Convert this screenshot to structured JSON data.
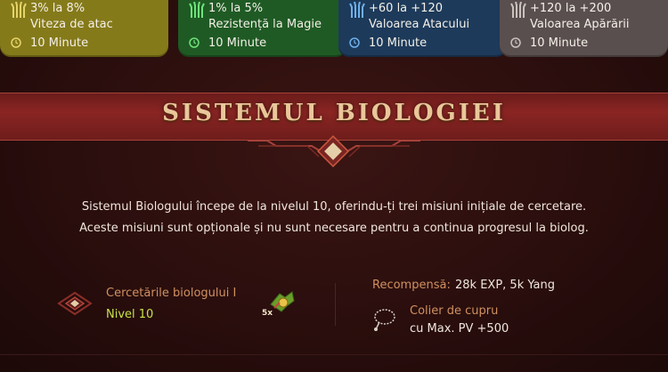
{
  "buffs": [
    {
      "icon": "claw-icon",
      "color": "#857a1a",
      "line1": "3% la 8%",
      "line2": "Viteza de atac",
      "duration": "10 Minute"
    },
    {
      "icon": "claw-icon",
      "color": "#1f5a24",
      "line1": "1% la 5%",
      "line2": "Rezistență la Magie",
      "duration": "10 Minute"
    },
    {
      "icon": "claw-icon",
      "color": "#1d3a5a",
      "line1": "+60 la +120",
      "line2": "Valoarea Atacului",
      "duration": "10 Minute"
    },
    {
      "icon": "claw-icon",
      "color": "#5a4f4f",
      "line1": "+120 la +200",
      "line2": "Valoarea Apărării",
      "duration": "10 Minute"
    }
  ],
  "section": {
    "title": "SISTEMUL BIOLOGIEI",
    "description_line1": "Sistemul Biologului începe de la nivelul 10, oferindu-ți trei misiuni inițiale de cercetare.",
    "description_line2": "Aceste misiuni sunt opționale și nu sunt necesare pentru a continua progresul la biolog."
  },
  "quest": {
    "name": "Cercetările biologului I",
    "level": "Nivel 10",
    "item_count": "5x",
    "reward_label": "Recompensă:",
    "reward_value": "28k EXP, 5k Yang",
    "reward_item_line1": "Colier de cupru",
    "reward_item_line2": "cu Max. PV +500"
  },
  "colors": {
    "banner": "#8a2523",
    "title": "#e9c79a",
    "quest_name": "#d09060",
    "level": "#c7e24a"
  }
}
